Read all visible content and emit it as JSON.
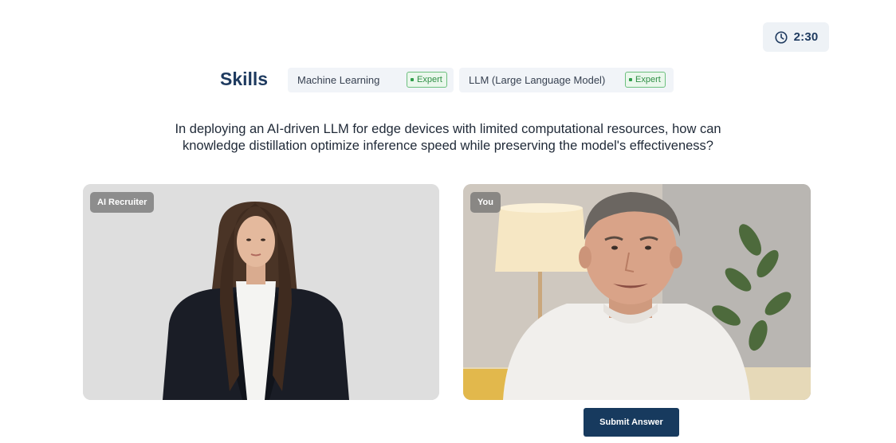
{
  "timer": {
    "value": "2:30",
    "icon": "clock-icon"
  },
  "skills": {
    "title": "Skills",
    "items": [
      {
        "name": "Machine Learning",
        "level": "Expert"
      },
      {
        "name": "LLM (Large Language Model)",
        "level": "Expert"
      }
    ]
  },
  "question": {
    "line1": "In deploying an AI-driven LLM for edge devices with limited computational resources, how can",
    "line2": "knowledge distillation optimize inference speed while preserving the model's effectiveness?"
  },
  "videos": {
    "recruiter": {
      "label": "AI Recruiter"
    },
    "candidate": {
      "label": "You"
    }
  },
  "actions": {
    "submit_label": "Submit Answer"
  },
  "colors": {
    "brand_navy": "#173a5e",
    "expert_green": "#2f9d4a",
    "card_bg": "#f1f4f8"
  }
}
